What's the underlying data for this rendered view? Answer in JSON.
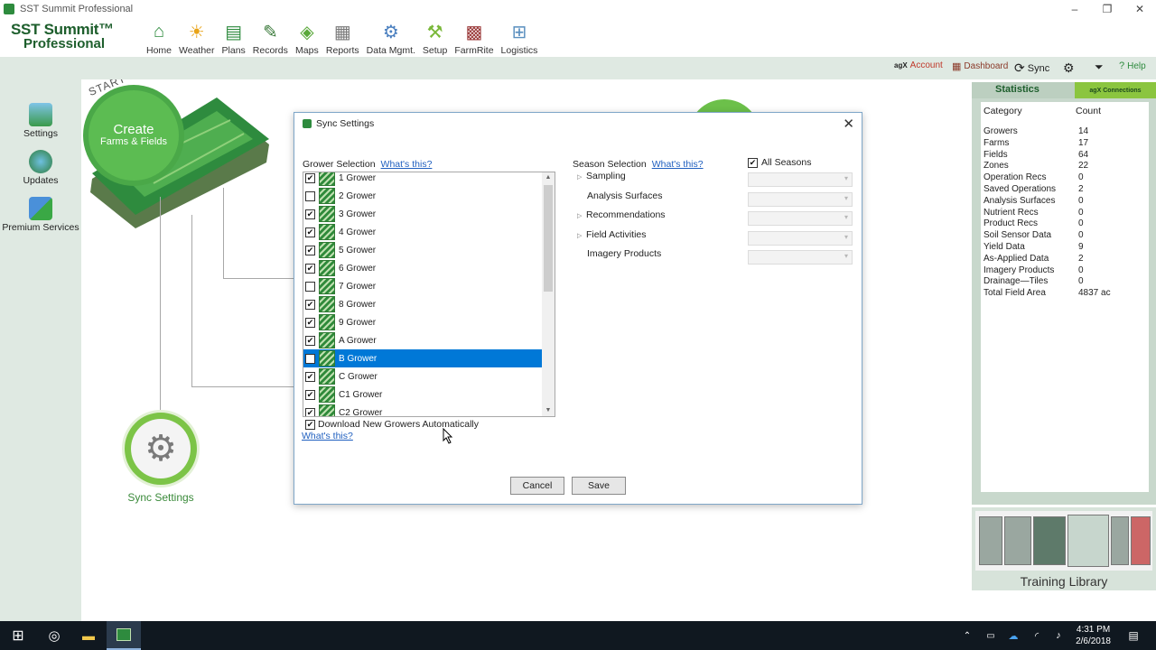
{
  "window": {
    "title": "SST Summit Professional",
    "controls": [
      "–",
      "❐",
      "✕"
    ]
  },
  "logo": {
    "line1": "SST Summit™",
    "line2": "Professional"
  },
  "nav": [
    {
      "label": "Home",
      "icon": "home-icon"
    },
    {
      "label": "Weather",
      "icon": "weather-icon"
    },
    {
      "label": "Plans",
      "icon": "plans-icon"
    },
    {
      "label": "Records",
      "icon": "records-icon"
    },
    {
      "label": "Maps",
      "icon": "maps-icon"
    },
    {
      "label": "Reports",
      "icon": "reports-icon"
    },
    {
      "label": "Data Mgmt.",
      "icon": "data-mgmt-icon"
    },
    {
      "label": "Setup",
      "icon": "setup-icon"
    },
    {
      "label": "FarmRite",
      "icon": "farmrite-icon"
    },
    {
      "label": "Logistics",
      "icon": "logistics-icon"
    }
  ],
  "toolbar": {
    "account": "Account",
    "account_prefix": "agX",
    "dashboard": "Dashboard",
    "sync": "Sync",
    "help": "Help"
  },
  "sidebar": [
    {
      "label": "Settings",
      "icon": "settings-icon"
    },
    {
      "label": "Updates",
      "icon": "updates-icon"
    },
    {
      "label": "Premium Services",
      "icon": "premium-services-icon"
    }
  ],
  "main": {
    "start_here": "START HERE",
    "create_line1": "Create",
    "create_line2": "Farms & Fields",
    "sync_settings": "Sync Settings"
  },
  "dialog": {
    "title": "Sync Settings",
    "grower_selection": "Grower Selection",
    "season_selection": "Season Selection",
    "whats_this": "What's this?",
    "all_seasons": "All Seasons",
    "all_seasons_checked": true,
    "growers": [
      {
        "name": "1 Grower",
        "checked": true,
        "selected": false
      },
      {
        "name": "2 Grower",
        "checked": false,
        "selected": false
      },
      {
        "name": "3 Grower",
        "checked": true,
        "selected": false
      },
      {
        "name": "4 Grower",
        "checked": true,
        "selected": false
      },
      {
        "name": "5 Grower",
        "checked": true,
        "selected": false
      },
      {
        "name": "6 Grower",
        "checked": true,
        "selected": false
      },
      {
        "name": "7 Grower",
        "checked": false,
        "selected": false
      },
      {
        "name": "8 Grower",
        "checked": true,
        "selected": false
      },
      {
        "name": "9 Grower",
        "checked": true,
        "selected": false
      },
      {
        "name": "A Grower",
        "checked": true,
        "selected": false
      },
      {
        "name": "B Grower",
        "checked": false,
        "selected": true
      },
      {
        "name": "C Grower",
        "checked": true,
        "selected": false
      },
      {
        "name": "C1 Grower",
        "checked": true,
        "selected": false
      },
      {
        "name": "C2 Grower",
        "checked": true,
        "selected": false
      }
    ],
    "seasons": [
      {
        "label": "Sampling",
        "expandable": true
      },
      {
        "label": "Analysis Surfaces",
        "expandable": false
      },
      {
        "label": "Recommendations",
        "expandable": true
      },
      {
        "label": "Field Activities",
        "expandable": true
      },
      {
        "label": "Imagery Products",
        "expandable": false
      }
    ],
    "download_auto": "Download New Growers Automatically",
    "download_auto_checked": true,
    "cancel": "Cancel",
    "save": "Save"
  },
  "statistics": {
    "title": "Statistics",
    "brand": "agX Connections",
    "col_category": "Category",
    "col_count": "Count",
    "rows": [
      {
        "category": "Growers",
        "count": "14"
      },
      {
        "category": "Farms",
        "count": "17"
      },
      {
        "category": "Fields",
        "count": "64"
      },
      {
        "category": "Zones",
        "count": "22"
      },
      {
        "category": "Operation Recs",
        "count": "0"
      },
      {
        "category": "Saved Operations",
        "count": "2"
      },
      {
        "category": "Analysis Surfaces",
        "count": "0"
      },
      {
        "category": "Nutrient Recs",
        "count": "0"
      },
      {
        "category": "Product Recs",
        "count": "0"
      },
      {
        "category": "Soil Sensor Data",
        "count": "0"
      },
      {
        "category": "Yield Data",
        "count": "9"
      },
      {
        "category": "As-Applied Data",
        "count": "2"
      },
      {
        "category": "Imagery Products",
        "count": "0"
      },
      {
        "category": "Drainage—Tiles",
        "count": "0"
      },
      {
        "category": "Total Field Area",
        "count": "4837 ac"
      }
    ]
  },
  "training": {
    "label": "Training Library"
  },
  "taskbar": {
    "time": "4:31 PM",
    "date": "2/6/2018"
  },
  "colors": {
    "brand_green": "#1d5e2c",
    "accent_green": "#8bc53f",
    "selection_blue": "#0078d7",
    "panel_green": "#dfe9e2"
  }
}
